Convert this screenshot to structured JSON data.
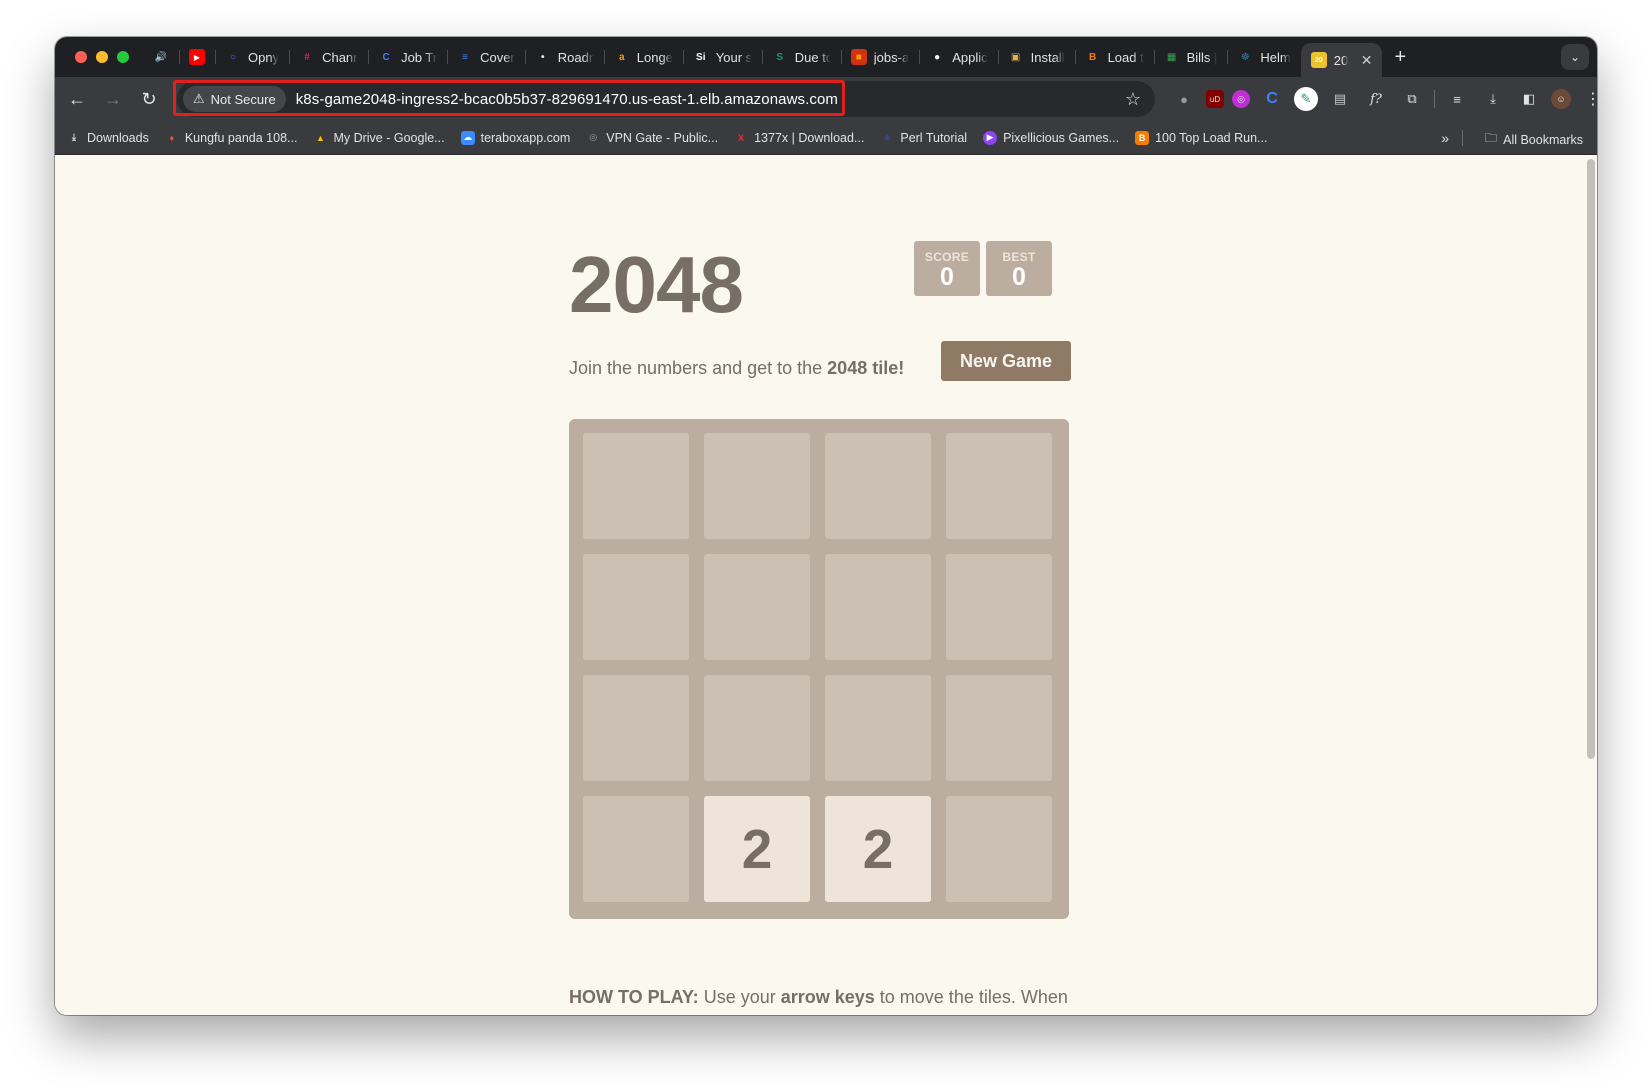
{
  "browser": {
    "tabs": [
      {
        "title": "",
        "icon": "speaker-icon"
      },
      {
        "title": "",
        "icon": "youtube-icon",
        "color": "#ff0000"
      },
      {
        "title": "Opny",
        "icon": "opny-icon",
        "color": "#5b6cff"
      },
      {
        "title": "Chann",
        "icon": "slack-icon",
        "color": "#e01e5a"
      },
      {
        "title": "Job Tr",
        "icon": "c-icon",
        "color": "#4a7cf7"
      },
      {
        "title": "Cover",
        "icon": "docs-icon",
        "color": "#4285f4"
      },
      {
        "title": "Roadn",
        "icon": "pin-icon",
        "color": "#e8e8e8"
      },
      {
        "title": "Longe",
        "icon": "amazon-icon",
        "color": "#ff9900"
      },
      {
        "title": "Your s",
        "icon": "si-icon",
        "color": "#ffffff"
      },
      {
        "title": "Due to",
        "icon": "shield-icon",
        "color": "#0e9f6e"
      },
      {
        "title": "jobs-a",
        "icon": "aws-icon",
        "color": "#d13212"
      },
      {
        "title": "Applic",
        "icon": "github-icon",
        "color": "#ffffff"
      },
      {
        "title": "Install",
        "icon": "package-icon",
        "color": "#e0b04a"
      },
      {
        "title": "Load t",
        "icon": "blogger-icon",
        "color": "#f57d00"
      },
      {
        "title": "Bills |",
        "icon": "sheet-icon",
        "color": "#34a853"
      },
      {
        "title": "Helm",
        "icon": "helm-icon",
        "color": "#277a9f"
      },
      {
        "title": "20",
        "icon": "2048-icon",
        "color": "#edc22e",
        "active": true
      }
    ],
    "new_tab_label": "+",
    "security_chip": "Not Secure",
    "url": "k8s-game2048-ingress2-bcac0b5b37-829691470.us-east-1.elb.amazonaws.com",
    "bookmarks": [
      {
        "label": "Downloads",
        "icon": "download-icon",
        "color": "#e3e3e3"
      },
      {
        "label": "Kungfu panda 108...",
        "icon": "flame-icon",
        "color": "#e8553f"
      },
      {
        "label": "My Drive - Google...",
        "icon": "drive-icon",
        "color": "#fbbc04"
      },
      {
        "label": "teraboxapp.com",
        "icon": "cloud-icon",
        "color": "#3a8bfd"
      },
      {
        "label": "VPN Gate - Public...",
        "icon": "globe-icon",
        "color": "#9aa0a6"
      },
      {
        "label": "1377x | Download...",
        "icon": "x-icon",
        "color": "#e2352b"
      },
      {
        "label": "Perl Tutorial",
        "icon": "perl-icon",
        "color": "#39457e"
      },
      {
        "label": "Pixellicious Games...",
        "icon": "play-icon",
        "color": "#8e44ef"
      },
      {
        "label": "100 Top Load Run...",
        "icon": "blogger-icon",
        "color": "#f57d00"
      }
    ],
    "all_bookmarks": "All Bookmarks"
  },
  "game": {
    "title": "2048",
    "score_label": "SCORE",
    "score": "0",
    "best_label": "BEST",
    "best": "0",
    "intro_prefix": "Join the numbers and get to the ",
    "intro_bold": "2048 tile!",
    "new_game": "New Game",
    "board": [
      [
        "",
        "",
        "",
        ""
      ],
      [
        "",
        "",
        "",
        ""
      ],
      [
        "",
        "",
        "",
        ""
      ],
      [
        "",
        "2",
        "2",
        ""
      ]
    ],
    "howto_label": "HOW TO PLAY:",
    "howto_text1": " Use your ",
    "howto_bold": "arrow keys",
    "howto_text2": " to move the tiles. When"
  },
  "colors": {
    "board": "#bbada0",
    "tile_2": "#eee4da",
    "text": "#776e65",
    "button": "#8f7a66",
    "highlight": "#e0201c"
  }
}
